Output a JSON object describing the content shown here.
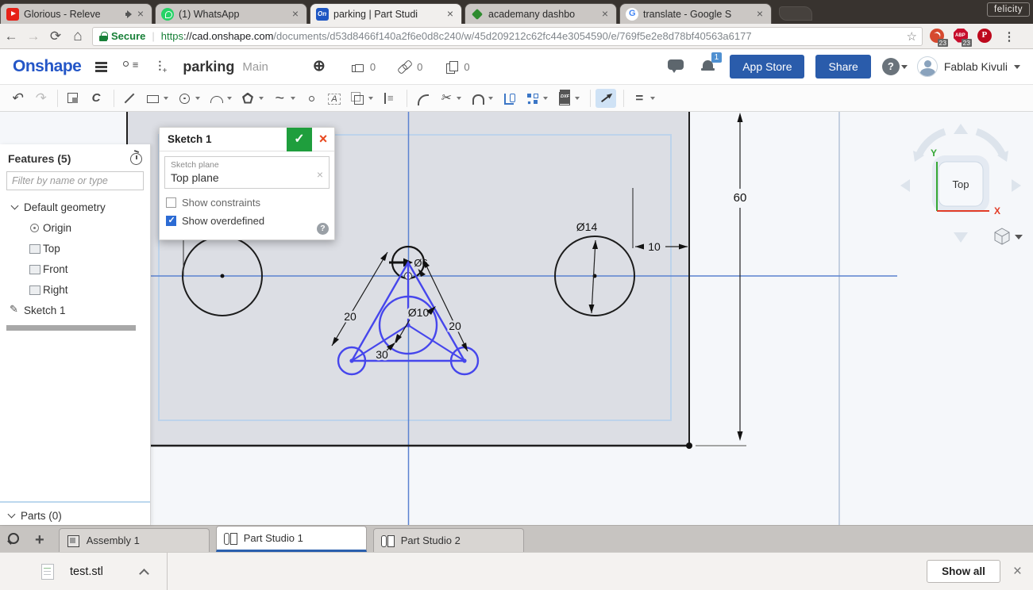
{
  "browser": {
    "tabs": [
      {
        "label": "Glorious - Releve",
        "cls": "",
        "fav": "fav-youtube",
        "fav_name": "youtube-icon",
        "audio": "show"
      },
      {
        "label": "(1) WhatsApp",
        "cls": "",
        "fav": "fav-whatsapp",
        "fav_name": "whatsapp-icon",
        "audio": ""
      },
      {
        "label": "parking | Part Studi",
        "cls": "active",
        "fav": "fav-onshape",
        "fav_name": "onshape-icon",
        "audio": ""
      },
      {
        "label": "academany dashbo",
        "cls": "",
        "fav": "fav-academany",
        "fav_name": "academany-icon",
        "audio": ""
      },
      {
        "label": "translate - Google S",
        "cls": "",
        "fav": "fav-google",
        "fav_name": "google-icon",
        "audio": ""
      }
    ],
    "window_badge": "felicity",
    "nav": {
      "secure_label": "Secure",
      "url_scheme": "https",
      "url_host": "://cad.onshape.com",
      "url_path": "/documents/d53d8466f140a2f6e0d8c240/w/45d209212c62fc44e3054590/e/769f5e2e8d78bf40563a6177",
      "ext_badge_1": "23",
      "ext_badge_2": "23"
    }
  },
  "header": {
    "logo": "Onshape",
    "doc_title": "parking",
    "workspace": "Main",
    "like_count": "0",
    "link_count": "0",
    "copy_count": "0",
    "notif_badge": "1",
    "app_store_label": "App Store",
    "share_label": "Share",
    "user_name": "Fablab Kivuli"
  },
  "toolbar": {
    "items": [
      {
        "name": "undo",
        "icon": "tb-undo",
        "dd": "",
        "cls": ""
      },
      {
        "name": "redo",
        "icon": "tb-redo",
        "dd": "",
        "cls": ""
      },
      {
        "name": "separator",
        "icon": "none",
        "dd": "",
        "cls": "sep"
      },
      {
        "name": "insert-image",
        "icon": "tb-sheet",
        "dd": "",
        "cls": ""
      },
      {
        "name": "construction-arc",
        "icon": "tb-c",
        "dd": "",
        "cls": ""
      },
      {
        "name": "separator",
        "icon": "none",
        "dd": "",
        "cls": "sep"
      },
      {
        "name": "line",
        "icon": "tb-line",
        "dd": "",
        "cls": ""
      },
      {
        "name": "rectangle",
        "icon": "tb-rect",
        "dd": "show",
        "cls": ""
      },
      {
        "name": "circle",
        "icon": "tb-circle",
        "dd": "show",
        "cls": ""
      },
      {
        "name": "arc",
        "icon": "tb-arc",
        "dd": "show",
        "cls": ""
      },
      {
        "name": "polygon",
        "icon": "tb-poly",
        "dd": "show",
        "cls": ""
      },
      {
        "name": "spline",
        "icon": "tb-spline",
        "dd": "show",
        "cls": ""
      },
      {
        "name": "point",
        "icon": "tb-point",
        "dd": "",
        "cls": ""
      },
      {
        "name": "sketch-text",
        "icon": "tb-text",
        "dd": "",
        "cls": ""
      },
      {
        "name": "mirror",
        "icon": "tb-mirror",
        "dd": "show",
        "cls": ""
      },
      {
        "name": "linear-pattern",
        "icon": "tb-lineardim",
        "dd": "",
        "cls": ""
      },
      {
        "name": "separator",
        "icon": "none",
        "dd": "",
        "cls": "sep"
      },
      {
        "name": "fillet",
        "icon": "tb-fillet",
        "dd": "",
        "cls": ""
      },
      {
        "name": "trim",
        "icon": "tb-trim",
        "dd": "show",
        "cls": ""
      },
      {
        "name": "offset",
        "icon": "tb-offset",
        "dd": "show",
        "cls": ""
      },
      {
        "name": "measure",
        "icon": "tb-measure",
        "dd": "",
        "cls": ""
      },
      {
        "name": "pattern",
        "icon": "tb-pattern",
        "dd": "show",
        "cls": ""
      },
      {
        "name": "import-dxf",
        "icon": "tb-dxf",
        "dd": "show",
        "cls": ""
      },
      {
        "name": "separator",
        "icon": "none",
        "dd": "",
        "cls": "sep"
      },
      {
        "name": "dimension",
        "icon": "tb-dim",
        "dd": "",
        "cls": "active"
      },
      {
        "name": "separator",
        "icon": "none",
        "dd": "",
        "cls": "sep"
      },
      {
        "name": "constraints",
        "icon": "tb-eq",
        "dd": "show",
        "cls": ""
      }
    ]
  },
  "features_panel": {
    "title": "Features (5)",
    "filter_placeholder": "Filter by name or type",
    "tree": [
      {
        "label": "Default geometry",
        "icon": "i-chevron",
        "icon_name": "chevron-down-icon",
        "ind": "ind0",
        "sel": ""
      },
      {
        "label": "Origin",
        "icon": "i-origin",
        "icon_name": "origin-icon",
        "ind": "ind1",
        "sel": ""
      },
      {
        "label": "Top",
        "icon": "i-plane",
        "icon_name": "plane-icon",
        "ind": "ind1",
        "sel": ""
      },
      {
        "label": "Front",
        "icon": "i-plane",
        "icon_name": "plane-icon",
        "ind": "ind1",
        "sel": ""
      },
      {
        "label": "Right",
        "icon": "i-plane",
        "icon_name": "plane-icon",
        "ind": "ind1",
        "sel": ""
      },
      {
        "label": "Sketch 1",
        "icon": "i-sketch",
        "icon_name": "sketch-icon",
        "ind": "ind0",
        "sel": "sel"
      }
    ],
    "parts_label": "Parts (0)"
  },
  "sketch_dialog": {
    "title": "Sketch 1",
    "plane_label": "Sketch plane",
    "plane_value": "Top plane",
    "cb1_label": "Show constraints",
    "cb1_state": "",
    "cb2_label": "Show overdefined",
    "cb2_state": "checked"
  },
  "canvas": {
    "dimensions": {
      "height": "60",
      "dia_right": "Ø14",
      "offset": "10",
      "side_left": "20",
      "side_right": "20",
      "width_bottom": "30",
      "dia_center": "Ø10",
      "dia_top": "Ø6"
    }
  },
  "view_cube": {
    "face": "Top",
    "axis_x": "X",
    "axis_y": "Y"
  },
  "doc_tabs": {
    "tabs": [
      {
        "label": "Assembly 1",
        "icon": "ic-assembly",
        "icon_name": "assembly-icon",
        "cls": ""
      },
      {
        "label": "Part Studio 1",
        "icon": "ic-partstudio",
        "icon_name": "part-studio-icon",
        "cls": "active"
      },
      {
        "label": "Part Studio 2",
        "icon": "ic-partstudio",
        "icon_name": "part-studio-icon",
        "cls": ""
      }
    ]
  },
  "download_bar": {
    "file_name": "test.stl",
    "show_all_label": "Show all"
  }
}
